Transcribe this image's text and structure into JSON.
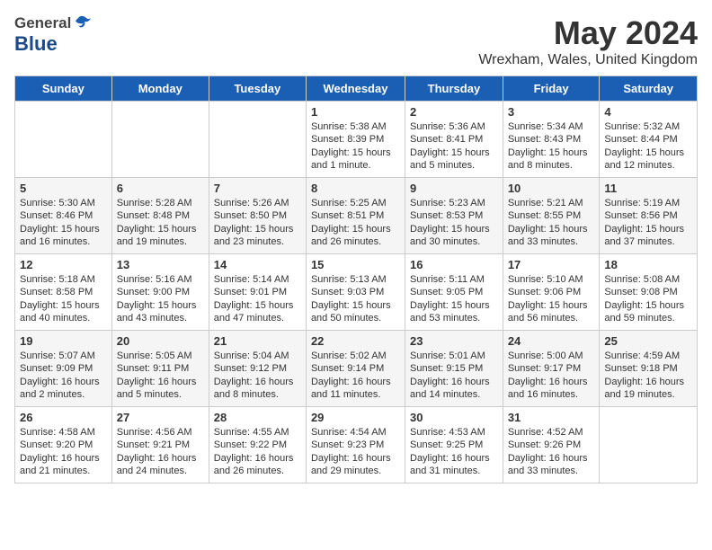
{
  "header": {
    "logo_general": "General",
    "logo_blue": "Blue",
    "title": "May 2024",
    "location": "Wrexham, Wales, United Kingdom"
  },
  "days_of_week": [
    "Sunday",
    "Monday",
    "Tuesday",
    "Wednesday",
    "Thursday",
    "Friday",
    "Saturday"
  ],
  "weeks": [
    [
      {
        "day": "",
        "info": ""
      },
      {
        "day": "",
        "info": ""
      },
      {
        "day": "",
        "info": ""
      },
      {
        "day": "1",
        "info": "Sunrise: 5:38 AM\nSunset: 8:39 PM\nDaylight: 15 hours and 1 minute."
      },
      {
        "day": "2",
        "info": "Sunrise: 5:36 AM\nSunset: 8:41 PM\nDaylight: 15 hours and 5 minutes."
      },
      {
        "day": "3",
        "info": "Sunrise: 5:34 AM\nSunset: 8:43 PM\nDaylight: 15 hours and 8 minutes."
      },
      {
        "day": "4",
        "info": "Sunrise: 5:32 AM\nSunset: 8:44 PM\nDaylight: 15 hours and 12 minutes."
      }
    ],
    [
      {
        "day": "5",
        "info": "Sunrise: 5:30 AM\nSunset: 8:46 PM\nDaylight: 15 hours and 16 minutes."
      },
      {
        "day": "6",
        "info": "Sunrise: 5:28 AM\nSunset: 8:48 PM\nDaylight: 15 hours and 19 minutes."
      },
      {
        "day": "7",
        "info": "Sunrise: 5:26 AM\nSunset: 8:50 PM\nDaylight: 15 hours and 23 minutes."
      },
      {
        "day": "8",
        "info": "Sunrise: 5:25 AM\nSunset: 8:51 PM\nDaylight: 15 hours and 26 minutes."
      },
      {
        "day": "9",
        "info": "Sunrise: 5:23 AM\nSunset: 8:53 PM\nDaylight: 15 hours and 30 minutes."
      },
      {
        "day": "10",
        "info": "Sunrise: 5:21 AM\nSunset: 8:55 PM\nDaylight: 15 hours and 33 minutes."
      },
      {
        "day": "11",
        "info": "Sunrise: 5:19 AM\nSunset: 8:56 PM\nDaylight: 15 hours and 37 minutes."
      }
    ],
    [
      {
        "day": "12",
        "info": "Sunrise: 5:18 AM\nSunset: 8:58 PM\nDaylight: 15 hours and 40 minutes."
      },
      {
        "day": "13",
        "info": "Sunrise: 5:16 AM\nSunset: 9:00 PM\nDaylight: 15 hours and 43 minutes."
      },
      {
        "day": "14",
        "info": "Sunrise: 5:14 AM\nSunset: 9:01 PM\nDaylight: 15 hours and 47 minutes."
      },
      {
        "day": "15",
        "info": "Sunrise: 5:13 AM\nSunset: 9:03 PM\nDaylight: 15 hours and 50 minutes."
      },
      {
        "day": "16",
        "info": "Sunrise: 5:11 AM\nSunset: 9:05 PM\nDaylight: 15 hours and 53 minutes."
      },
      {
        "day": "17",
        "info": "Sunrise: 5:10 AM\nSunset: 9:06 PM\nDaylight: 15 hours and 56 minutes."
      },
      {
        "day": "18",
        "info": "Sunrise: 5:08 AM\nSunset: 9:08 PM\nDaylight: 15 hours and 59 minutes."
      }
    ],
    [
      {
        "day": "19",
        "info": "Sunrise: 5:07 AM\nSunset: 9:09 PM\nDaylight: 16 hours and 2 minutes."
      },
      {
        "day": "20",
        "info": "Sunrise: 5:05 AM\nSunset: 9:11 PM\nDaylight: 16 hours and 5 minutes."
      },
      {
        "day": "21",
        "info": "Sunrise: 5:04 AM\nSunset: 9:12 PM\nDaylight: 16 hours and 8 minutes."
      },
      {
        "day": "22",
        "info": "Sunrise: 5:02 AM\nSunset: 9:14 PM\nDaylight: 16 hours and 11 minutes."
      },
      {
        "day": "23",
        "info": "Sunrise: 5:01 AM\nSunset: 9:15 PM\nDaylight: 16 hours and 14 minutes."
      },
      {
        "day": "24",
        "info": "Sunrise: 5:00 AM\nSunset: 9:17 PM\nDaylight: 16 hours and 16 minutes."
      },
      {
        "day": "25",
        "info": "Sunrise: 4:59 AM\nSunset: 9:18 PM\nDaylight: 16 hours and 19 minutes."
      }
    ],
    [
      {
        "day": "26",
        "info": "Sunrise: 4:58 AM\nSunset: 9:20 PM\nDaylight: 16 hours and 21 minutes."
      },
      {
        "day": "27",
        "info": "Sunrise: 4:56 AM\nSunset: 9:21 PM\nDaylight: 16 hours and 24 minutes."
      },
      {
        "day": "28",
        "info": "Sunrise: 4:55 AM\nSunset: 9:22 PM\nDaylight: 16 hours and 26 minutes."
      },
      {
        "day": "29",
        "info": "Sunrise: 4:54 AM\nSunset: 9:23 PM\nDaylight: 16 hours and 29 minutes."
      },
      {
        "day": "30",
        "info": "Sunrise: 4:53 AM\nSunset: 9:25 PM\nDaylight: 16 hours and 31 minutes."
      },
      {
        "day": "31",
        "info": "Sunrise: 4:52 AM\nSunset: 9:26 PM\nDaylight: 16 hours and 33 minutes."
      },
      {
        "day": "",
        "info": ""
      }
    ]
  ]
}
